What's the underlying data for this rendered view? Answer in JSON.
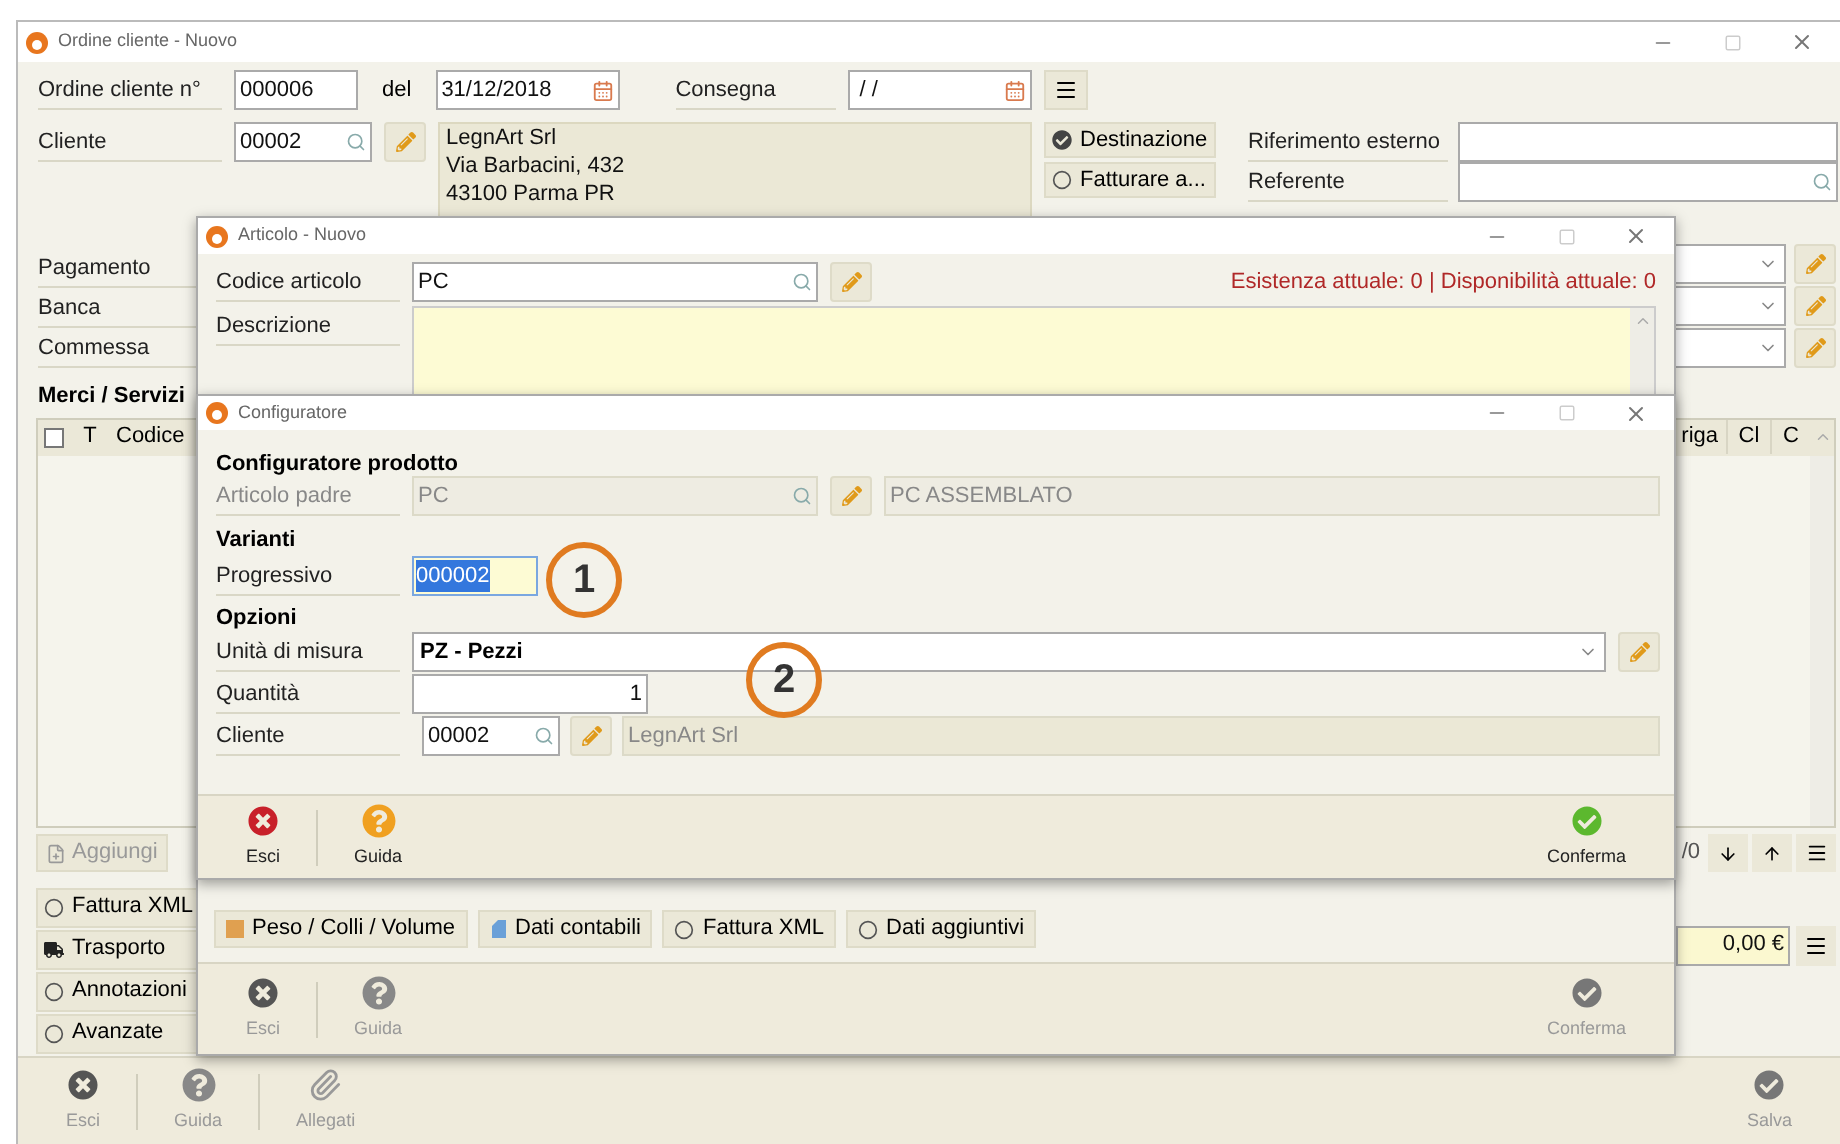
{
  "main": {
    "title": "Ordine cliente - Nuovo",
    "order_label": "Ordine cliente n°",
    "order_no": "000006",
    "date_label": "del",
    "date": "31/12/2018",
    "delivery_label": "Consegna",
    "delivery": " / /",
    "customer_label": "Cliente",
    "customer_code": "00002",
    "address": [
      "LegnArt Srl",
      "Via Barbacini, 432",
      "43100 Parma PR"
    ],
    "address_options": [
      {
        "label": "Destinazione",
        "selected": true
      },
      {
        "label": "Fatturare a...",
        "selected": false
      }
    ],
    "external_ref_label": "Riferimento esterno",
    "contact_label": "Referente",
    "left_labels": [
      "Pagamento",
      "Banca",
      "Commessa"
    ],
    "goods_title": "Merci / Servizi",
    "select_all": {
      "checked": false
    },
    "columns_left": [
      "T",
      "Codice"
    ],
    "columns_right": [
      "riga",
      "Cl",
      "C"
    ],
    "add_button": "Aggiungi",
    "pager": "/0",
    "side_buttons": [
      {
        "kind": "radio",
        "label": "Fattura XML"
      },
      {
        "kind": "truck",
        "label": "Trasporto"
      },
      {
        "kind": "radio",
        "label": "Annotazioni"
      },
      {
        "kind": "radio",
        "label": "Avanzate"
      }
    ],
    "total": "0,00 €",
    "footer": [
      {
        "kind": "exit",
        "label": "Esci",
        "disabled": true
      },
      {
        "kind": "help",
        "label": "Guida",
        "disabled": true
      },
      {
        "kind": "attach",
        "label": "Allegati",
        "disabled": true
      },
      {
        "kind": "confirm",
        "label": "Salva",
        "disabled": true
      }
    ]
  },
  "article": {
    "title": "Articolo - Nuovo",
    "code_label": "Codice articolo",
    "code": "PC",
    "stock": "Esistenza attuale: 0 | Disponibilità attuale: 0",
    "description_label": "Descrizione",
    "tabs": [
      {
        "kind": "weight",
        "label": "Peso / Colli / Volume"
      },
      {
        "kind": "account",
        "label": "Dati contabili"
      },
      {
        "kind": "radio",
        "label": "Fattura XML"
      },
      {
        "kind": "radio",
        "label": "Dati aggiuntivi"
      }
    ],
    "footer": [
      {
        "kind": "exit",
        "label": "Esci",
        "disabled": true
      },
      {
        "kind": "help",
        "label": "Guida",
        "disabled": true
      },
      {
        "kind": "confirm",
        "label": "Conferma",
        "disabled": true
      }
    ]
  },
  "configurator": {
    "title": "Configuratore",
    "section_product": "Configuratore prodotto",
    "parent_label": "Articolo padre",
    "parent_code": "PC",
    "parent_name": "PC ASSEMBLATO",
    "section_variants": "Varianti",
    "progressive_label": "Progressivo",
    "progressive": {
      "value": "000002",
      "selected": true
    },
    "section_options": "Opzioni",
    "unit_label": "Unità di misura",
    "unit": "PZ - Pezzi",
    "quantity_label": "Quantità",
    "quantity": "1",
    "customer_label": "Cliente",
    "customer_code": "00002",
    "customer_name": "LegnArt Srl",
    "footer": [
      {
        "kind": "exit",
        "label": "Esci",
        "disabled": false
      },
      {
        "kind": "help",
        "label": "Guida",
        "disabled": false
      },
      {
        "kind": "confirm",
        "label": "Conferma",
        "disabled": false
      }
    ]
  },
  "callouts": [
    {
      "label": "1"
    },
    {
      "label": "2"
    }
  ]
}
